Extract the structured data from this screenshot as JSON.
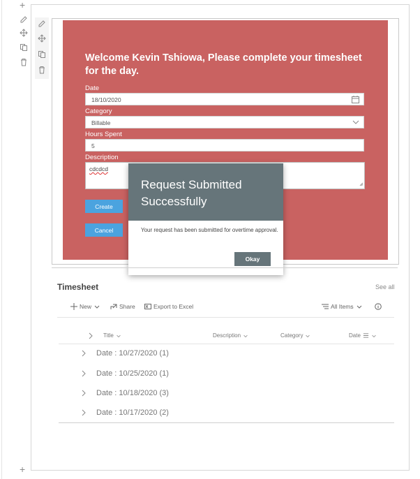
{
  "form": {
    "welcome": "Welcome Kevin Tshiowa, Please complete your timesheet for the day.",
    "date_label": "Date",
    "date_value": "18/10/2020",
    "category_label": "Category",
    "category_value": "Billable",
    "hours_label": "Hours Spent",
    "hours_value": "5",
    "description_label": "Description",
    "description_value": "cdcdcd",
    "create_label": "Create",
    "cancel_label": "Cancel",
    "bg_color": "#c96261",
    "button_color": "#4ba3df"
  },
  "dialog": {
    "title": "Request Submitted Successfully",
    "message": "Your request has been submitted for overtime approval.",
    "ok_label": "Okay",
    "header_color": "#66757a"
  },
  "list": {
    "title": "Timesheet",
    "see_all": "See all",
    "commands": {
      "new": "New",
      "share": "Share",
      "export": "Export to Excel",
      "view": "All Items"
    },
    "columns": [
      "Title",
      "Description",
      "Category",
      "Date"
    ],
    "groups": [
      "Date : 10/27/2020 (1)",
      "Date : 10/25/2020 (1)",
      "Date : 10/18/2020 (3)",
      "Date : 10/17/2020 (2)"
    ]
  },
  "icons": [
    "add-section-icon",
    "edit-icon",
    "move-icon",
    "duplicate-icon",
    "delete-icon",
    "calendar-icon",
    "chevron-down-icon",
    "share-icon",
    "excel-icon",
    "view-icon",
    "info-icon",
    "chevron-right-icon"
  ]
}
